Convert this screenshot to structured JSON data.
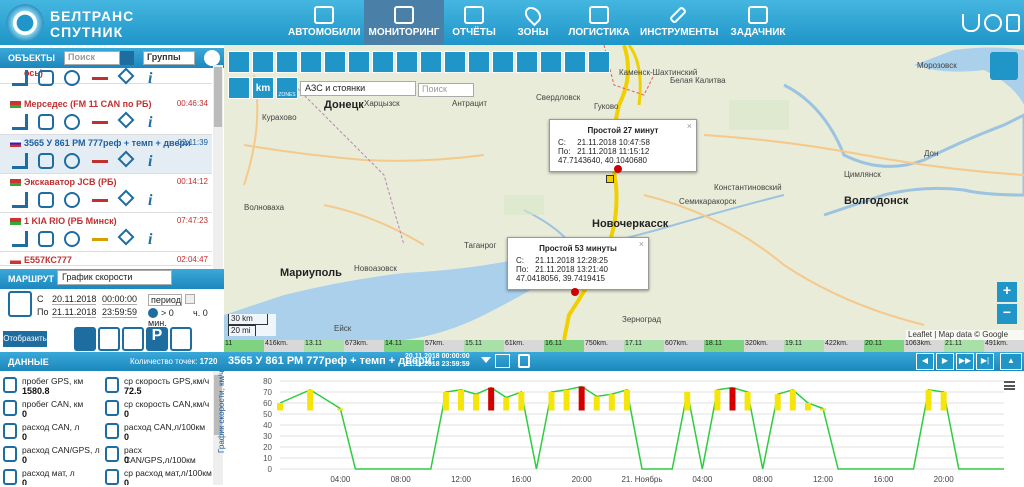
{
  "brand": {
    "line1": "БЕЛТРАНС",
    "line2": "СПУТНИК"
  },
  "nav": [
    {
      "label": "АВТОМОБИЛИ",
      "active": false
    },
    {
      "label": "МОНИТОРИНГ",
      "active": true
    },
    {
      "label": "ОТЧЁТЫ",
      "active": false
    },
    {
      "label": "ЗОНЫ",
      "active": false
    },
    {
      "label": "ЛОГИСТИКА",
      "active": false
    },
    {
      "label": "ИНСТРУМЕНТЫ",
      "active": false
    },
    {
      "label": "ЗАДАЧНИК",
      "active": false
    }
  ],
  "objects": {
    "title": "ОБЪЕКТЫ",
    "search_placeholder": "Поиск",
    "groups_label": "Группы",
    "items": [
      {
        "name": "ось)",
        "time": "",
        "selected": false
      },
      {
        "name": "Мерседес (FM 11 CAN по РБ)",
        "time": "00:46:34",
        "selected": false
      },
      {
        "name": "3565 У 861 РМ 777реф + темп + двери",
        "time": "02:11:39",
        "selected": true
      },
      {
        "name": "Экскаватор JCB (РБ)",
        "time": "00:14:12",
        "selected": false
      },
      {
        "name": "1 KIA RIO (РБ Минск)",
        "time": "07:47:23",
        "selected": false
      },
      {
        "name": "Е557КС777",
        "time": "02:04:47",
        "selected": false
      }
    ]
  },
  "route": {
    "title": "МАРШРУТ",
    "select_value": "График скорости",
    "from_label": "С",
    "to_label": "По",
    "from_date": "20.11.2018",
    "from_time": "00:00:00",
    "to_date": "21.11.2018",
    "to_time": "23:59:59",
    "period_label": "период",
    "speed_gt": "> 0",
    "speed_unit": "мин.",
    "hours_label": "ч. 0",
    "show_button": "Отобразить"
  },
  "map": {
    "layer_select": "АЗС и стоянки",
    "search_placeholder": "Поиск",
    "km_button": "km",
    "zones_label": "ZONES",
    "scale_km": "30 km",
    "scale_mi": "20 mi",
    "attribution": "Leaflet | Map data © Google maps",
    "popups": [
      {
        "title": "Простой 27 минут",
        "from_label": "С:",
        "from": "21.11.2018 10:47:58",
        "to_label": "По:",
        "to": "21.11.2018 11:15:12",
        "coords": "47.7143640, 40.1040680"
      },
      {
        "title": "Простой 53 минуты",
        "from_label": "С:",
        "from": "21.11.2018 12:28:25",
        "to_label": "По:",
        "to": "21.11.2018 13:21:40",
        "coords": "47.0418056, 39.7419415"
      }
    ],
    "cities": [
      {
        "name": "Донецк",
        "big": true
      },
      {
        "name": "Мариуполь",
        "big": true
      },
      {
        "name": "Новочеркасск",
        "big": true
      },
      {
        "name": "Волгодонск",
        "big": true
      },
      {
        "name": "Таганрог",
        "big": false
      },
      {
        "name": "Харцызск",
        "big": false
      },
      {
        "name": "Антрацит",
        "big": false
      },
      {
        "name": "Свердловск",
        "big": false
      },
      {
        "name": "Гуково",
        "big": false
      },
      {
        "name": "Каменск-Шахтинский",
        "big": false
      },
      {
        "name": "Белая Калитва",
        "big": false
      },
      {
        "name": "Морозовск",
        "big": false
      },
      {
        "name": "Цимлянск",
        "big": false
      },
      {
        "name": "Семикаракорск",
        "big": false
      },
      {
        "name": "Зерноград",
        "big": false
      },
      {
        "name": "Ейск",
        "big": false
      },
      {
        "name": "Дон",
        "big": false
      },
      {
        "name": "Кураховo",
        "big": false
      },
      {
        "name": "Волноваха",
        "big": false
      },
      {
        "name": "Новоазовск",
        "big": false
      },
      {
        "name": "Константиновский",
        "big": false
      }
    ]
  },
  "speed_strip": [
    "11",
    "416km.",
    "13.11",
    "673km.",
    "14.11",
    "57km.",
    "15.11",
    "61km.",
    "16.11",
    "750km.",
    "17.11",
    "607km.",
    "18.11",
    "320km.",
    "19.11",
    "422km.",
    "20.11",
    "1063km.",
    "21.11",
    "491km."
  ],
  "bottom": {
    "data_title": "ДАННЫЕ",
    "points_label": "Количество точек:",
    "points_value": "1720",
    "vehicle_title": "3565 У 861 РМ 777реф + темп + двери:",
    "date_from": "20.11.2018 00:00:00",
    "date_to": "21.11.2018 23:59:59"
  },
  "data_cells": [
    {
      "label": "пробег GPS, км",
      "value": "1580.8"
    },
    {
      "label": "ср скорость GPS,км/ч",
      "value": "72.5"
    },
    {
      "label": "пробег CAN, км",
      "value": "0"
    },
    {
      "label": "ср скорость CAN,км/ч",
      "value": "0"
    },
    {
      "label": "расход CAN, л",
      "value": "0"
    },
    {
      "label": "расход CAN,л/100км",
      "value": "0"
    },
    {
      "label": "расход CAN/GPS, л",
      "value": "0"
    },
    {
      "label": "расх CAN/GPS,л/100км",
      "value": "0"
    },
    {
      "label": "расход мат, л",
      "value": "0"
    },
    {
      "label": "ср расход мат,л/100км",
      "value": "0"
    }
  ],
  "chart_data": {
    "type": "line",
    "title": "",
    "ylabel": "График скорости, км/ч",
    "xlabel": "",
    "ylim": [
      0,
      80
    ],
    "yticks": [
      0,
      10,
      20,
      30,
      40,
      50,
      60,
      70,
      80
    ],
    "xticks": [
      "04:00",
      "08:00",
      "12:00",
      "16:00",
      "20:00",
      "21. Ноябрь",
      "04:00",
      "08:00",
      "12:00",
      "16:00",
      "20:00"
    ],
    "x_hours": [
      0,
      2,
      4,
      5,
      6,
      7,
      8,
      9,
      10,
      11,
      12,
      13,
      14,
      15,
      16,
      17,
      18,
      19,
      20,
      21,
      22,
      23,
      24,
      25,
      26,
      27,
      28,
      29,
      30,
      31,
      32,
      33,
      34,
      35,
      36,
      37,
      38,
      39,
      40,
      41,
      42,
      43,
      44,
      45,
      46,
      47,
      48
    ],
    "series": [
      {
        "name": "",
        "values": [
          60,
          72,
          55,
          0,
          0,
          0,
          0,
          0,
          0,
          70,
          72,
          68,
          74,
          65,
          70,
          0,
          70,
          72,
          75,
          66,
          68,
          72,
          0,
          0,
          0,
          70,
          0,
          72,
          74,
          70,
          0,
          68,
          72,
          60,
          55,
          0,
          0,
          0,
          0,
          0,
          0,
          72,
          70,
          0,
          0,
          0,
          0
        ]
      }
    ],
    "colors": {
      "low": "#2ecc40",
      "mid": "#f5e50a",
      "high": "#d40000"
    }
  }
}
